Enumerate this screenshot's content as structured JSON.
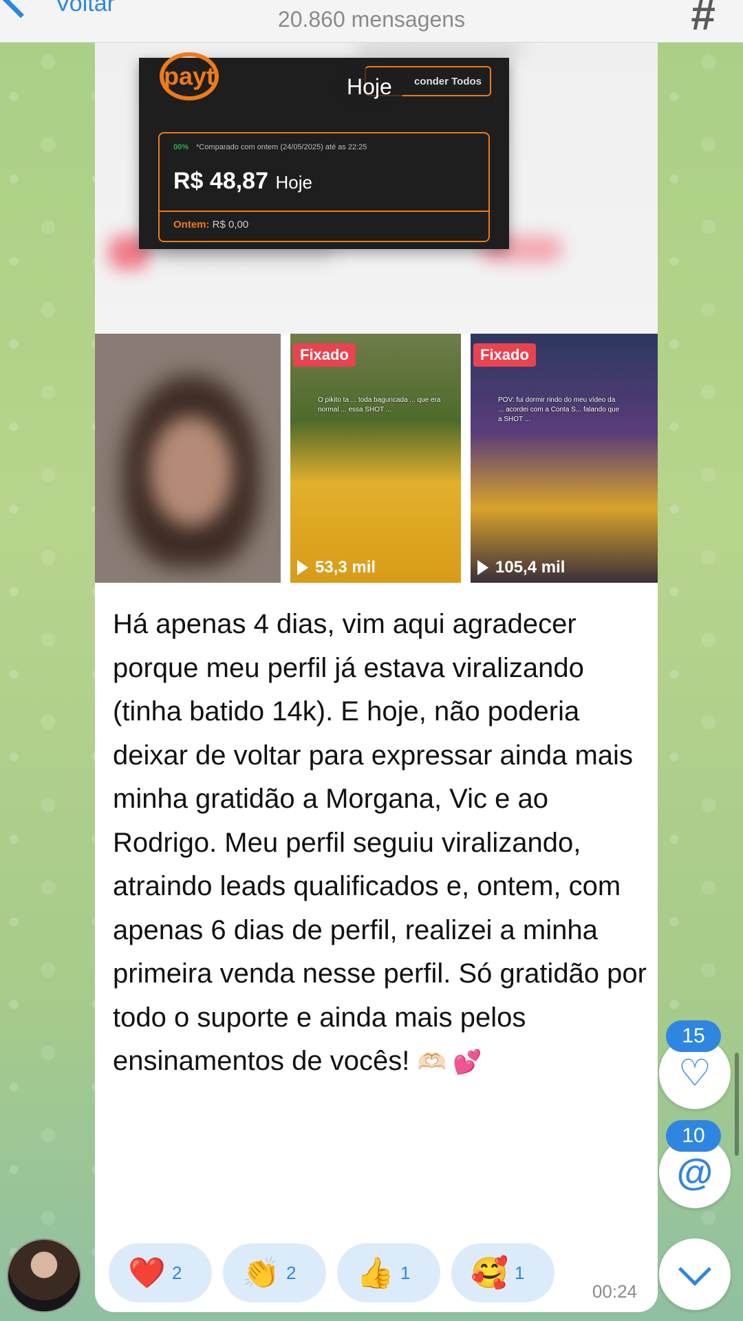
{
  "header": {
    "back_label": "Voltar",
    "title": "20.860 mensagens",
    "hash_icon": "#"
  },
  "message": {
    "date_pill": "Hoje",
    "dashboard": {
      "logo_text": "payt",
      "hide_button": "conder Todos",
      "trend_label": "00%",
      "compare_text": "*Comparado com ontem (24/05/2025) até as 22:25",
      "amount": "R$ 48,87",
      "amount_suffix": "Hoje",
      "yesterday_label": "Ontem:",
      "yesterday_value": "R$ 0,00"
    },
    "thumbnails": [
      {
        "pinned": "",
        "views": ""
      },
      {
        "pinned": "Fixado",
        "views": "53,3 mil",
        "caption": "O pikito ta ... toda baguncada ... que era normal ... essa SHOT ..."
      },
      {
        "pinned": "Fixado",
        "views": "105,4 mil",
        "caption": "POV: fui dormir rindo do meu vídeo da ... acordei com a Conta S... falando que a SHOT ..."
      }
    ],
    "text": "Há apenas 4 dias, vim aqui agradecer porque meu perfil já estava viralizando (tinha batido 14k). E hoje, não poderia deixar de voltar para expressar ainda mais minha gratidão a Morgana, Vic e ao Rodrigo. Meu perfil seguiu viralizando, atraindo leads qualificados e, ontem, com apenas 6 dias de perfil, realizei a minha primeira venda nesse perfil. Só gratidão por todo o suporte e ainda mais pelos ensinamentos de vocês!",
    "text_emoji": "🫶🏻 💕",
    "reactions": [
      {
        "emoji": "❤️",
        "count": "2"
      },
      {
        "emoji": "👏",
        "count": "2"
      },
      {
        "emoji": "👍",
        "count": "1"
      },
      {
        "emoji": "🥰",
        "count": "1"
      }
    ],
    "time": "00:24"
  },
  "side_controls": {
    "reactions_badge": "15",
    "mentions_badge": "10",
    "heart_icon": "♡",
    "at_icon": "@"
  }
}
